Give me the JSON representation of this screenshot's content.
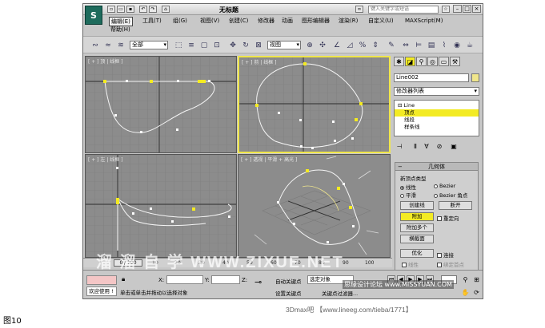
{
  "app": {
    "logo": "S",
    "doc_title": "无标题",
    "help_search_placeholder": "键入关键字或短语",
    "menus": [
      {
        "label": "编辑(E)",
        "active": true
      },
      {
        "label": "工具(T)"
      },
      {
        "label": "组(G)"
      },
      {
        "label": "视图(V)"
      },
      {
        "label": "创建(C)"
      },
      {
        "label": "修改器"
      },
      {
        "label": "动画"
      },
      {
        "label": "图形编辑器"
      },
      {
        "label": "渲染(R)"
      },
      {
        "label": "自定义(U)"
      },
      {
        "label": "MAXScript(M)"
      },
      {
        "label": "帮助(H)"
      }
    ]
  },
  "toolbar": {
    "selection_filter": "全部",
    "ref_coord": "视图"
  },
  "viewports": {
    "top": {
      "label": "[ + ] 顶 | 线框 ]"
    },
    "front": {
      "label": "[ + ] 前 | 线框 ]"
    },
    "left": {
      "label": "[ + ] 左 | 线框 ]"
    },
    "persp": {
      "label": "[ + ] 透视 | 平滑 + 高光 ]"
    }
  },
  "command_panel": {
    "object_name": "Line002",
    "modifier_list": "修改器列表",
    "stack": [
      {
        "label": "Line",
        "prefix": "⊟"
      },
      {
        "label": "顶点",
        "selected": true
      },
      {
        "label": "线段"
      },
      {
        "label": "样条线"
      }
    ],
    "rollout_title": "几何体",
    "new_vertex_type": "新顶点类型",
    "radios": {
      "linear": "线性",
      "bezier": "Bezier",
      "smooth": "平滑",
      "bezier_corner": "Bezier 角点"
    },
    "buttons": {
      "create_line": "创建线",
      "break": "断开",
      "attach": "附加",
      "reorient": "重定向",
      "attach_mult": "附加多个",
      "cross_section": "横截面",
      "optimize": "优化",
      "connect": "连接",
      "linear_chk": "线性",
      "bind_first": "绑定首点"
    }
  },
  "timeline": {
    "slider": "0 / 100",
    "ticks": [
      "0",
      "10",
      "20",
      "30",
      "40",
      "50",
      "60",
      "70",
      "80",
      "90",
      "100"
    ]
  },
  "status": {
    "welcome": "欢迎使用 !",
    "prompt": "单击或单击并拖动以选择对象",
    "x_label": "X:",
    "y_label": "Y:",
    "z_label": "Z:",
    "auto_key": "自动关键点",
    "set_key": "设置关键点",
    "key_filters": "关键点过滤器...",
    "selected_obj": "选定对象"
  },
  "overlays": {
    "figure_caption": "图10",
    "credit": "3Dmax吧 【www.lineeg.com/tieba/1771】",
    "watermark": "溜 溜 自 学  WWW.ZIXUE.NET",
    "site": "思缘设计论坛 www.MISSYUAN.COM"
  }
}
